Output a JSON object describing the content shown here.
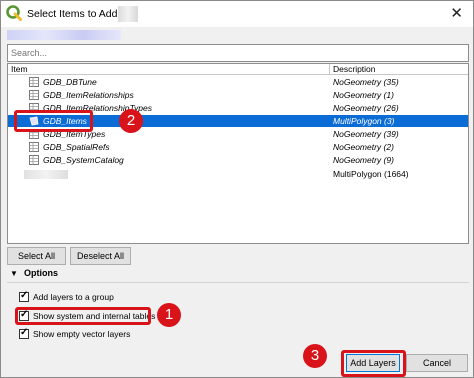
{
  "window": {
    "title": "Select Items to Add |"
  },
  "search": {
    "placeholder": "Search..."
  },
  "table": {
    "headers": {
      "item": "Item",
      "description": "Description"
    },
    "rows": [
      {
        "name": "GDB_DBTune",
        "description": "NoGeometry (35)",
        "icon": "table-icon"
      },
      {
        "name": "GDB_ItemRelationships",
        "description": "NoGeometry (1)",
        "icon": "table-icon"
      },
      {
        "name": "GDB_ItemRelationshipTypes",
        "description": "NoGeometry (26)",
        "icon": "table-icon"
      },
      {
        "name": "GDB_Items",
        "description": "MultiPolygon (3)",
        "icon": "polygon-icon",
        "selected": true
      },
      {
        "name": "GDB_ItemTypes",
        "description": "NoGeometry (39)",
        "icon": "table-icon"
      },
      {
        "name": "GDB_SpatialRefs",
        "description": "NoGeometry (2)",
        "icon": "table-icon"
      },
      {
        "name": "GDB_SystemCatalog",
        "description": "NoGeometry (9)",
        "icon": "table-icon"
      },
      {
        "name": "",
        "description": "MultiPolygon (1664)",
        "icon": ""
      }
    ]
  },
  "buttons": {
    "select_all": "Select All",
    "deselect_all": "Deselect All",
    "add_layers": "Add Layers",
    "cancel": "Cancel"
  },
  "options": {
    "header": "Options",
    "items": [
      {
        "label": "Add layers to a group",
        "checked": true
      },
      {
        "label": "Show system and internal tables",
        "checked": true
      },
      {
        "label": "Show empty vector layers",
        "checked": true
      }
    ]
  },
  "annotations": [
    "1",
    "2",
    "3"
  ],
  "colors": {
    "selection": "#0c6cd6",
    "highlight": "#d8141a",
    "qgis_green": "#589632",
    "qgis_yellow": "#eebc2c"
  }
}
